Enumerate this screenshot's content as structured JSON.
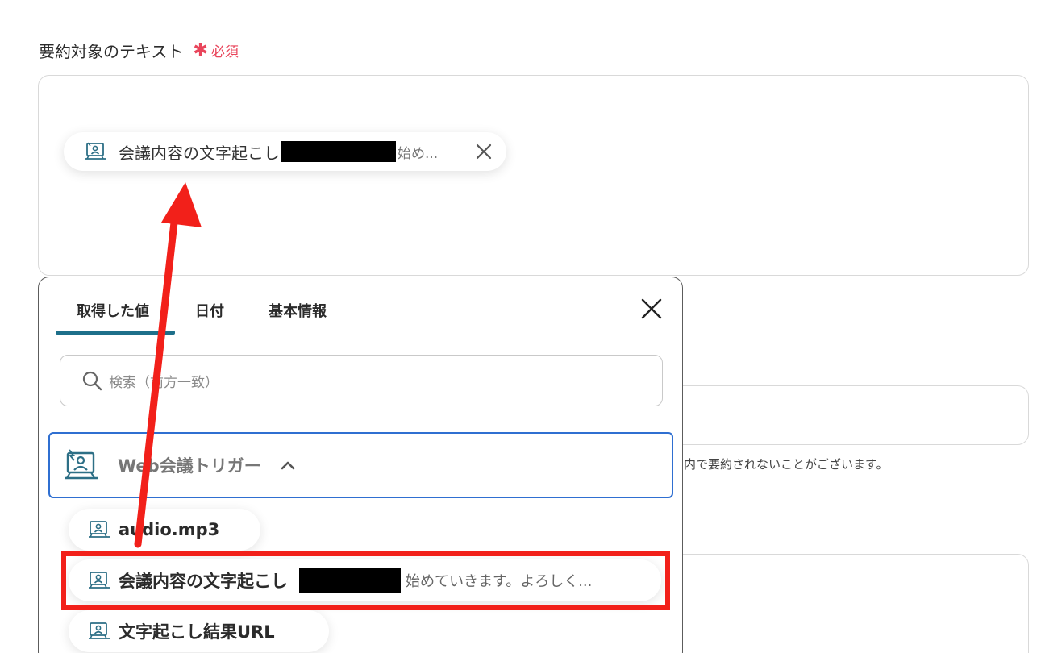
{
  "field": {
    "label": "要約対象のテキスト",
    "required_mark": "✱",
    "required_label": "必須"
  },
  "selected_chip": {
    "name": "会議内容の文字起こし",
    "preview": "始め..."
  },
  "hint_text": "内で要約されないことがございます。",
  "panel": {
    "tabs": [
      {
        "label": "取得した値",
        "active": true
      },
      {
        "label": "日付",
        "active": false
      },
      {
        "label": "基本情報",
        "active": false
      }
    ],
    "search_placeholder": "検索（前方一致）",
    "trigger": {
      "label": "Web会議トリガー",
      "icon": "web-meeting-icon",
      "expanded": true
    },
    "items": [
      {
        "name": "audio.mp3",
        "icon": "meeting-item-icon"
      },
      {
        "name": "会議内容の文字起こし",
        "preview": "始めていきます。よろしく...",
        "icon": "meeting-item-icon"
      },
      {
        "name": "文字起こし結果URL",
        "icon": "meeting-item-icon"
      }
    ]
  },
  "colors": {
    "required": "#e9455b",
    "tab_active": "#1d6f8a",
    "trigger_border": "#2f6fd1",
    "annotation": "#f2201a",
    "icon": "#2d6f86"
  }
}
